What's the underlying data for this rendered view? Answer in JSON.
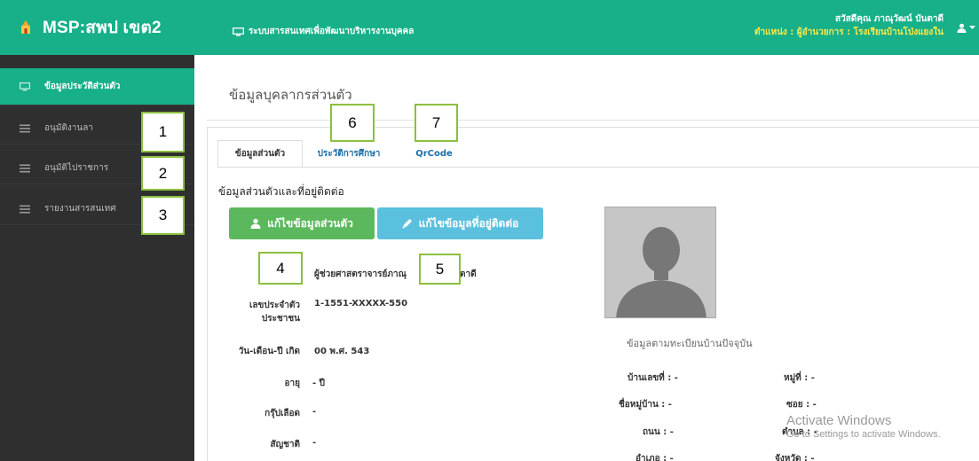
{
  "header": {
    "brand_title": "MSP:สพป เขต2",
    "system_title": "ระบบสารสนเทศเพื่อพัฒนาบริหารงานบุคคล",
    "user_greeting": "สวัสดีคุณ ภาณุวัฒน์ บันตาดี",
    "user_position": "ตำแหน่ง : ผู้อำนวยการ : โรงเรียนบ้านโป่งแยงใน",
    "brand_color": "#17b088"
  },
  "sidebar": {
    "items": [
      {
        "label": "ข้อมูลประวัติส่วนตัว",
        "icon": "monitor-icon"
      },
      {
        "label": "อนุมัติงานลา",
        "icon": "list-icon"
      },
      {
        "label": "อนุมัติไปราชการ",
        "icon": "list-icon"
      },
      {
        "label": "รายงานสารสนเทศ",
        "icon": "list-icon"
      }
    ]
  },
  "annotations": [
    "1",
    "2",
    "3",
    "4",
    "5",
    "6",
    "7"
  ],
  "main": {
    "page_title": "ข้อมูลบุคลากรส่วนตัว",
    "tabs": [
      "ข้อมูลส่วนตัว",
      "ประวัติการศึกษา",
      "QrCode"
    ],
    "section_title": "ข้อมูลส่วนตัวและที่อยู่ติดต่อ",
    "edit_personal_button": "แก้ไขข้อมูลส่วนตัว",
    "edit_address_button": "แก้ไขข้อมูลที่อยู่ติดต่อ",
    "name_left": "ผู้ช่วยศาสตราจารย์ภาณุ",
    "name_right": "ตาดี",
    "fields": [
      {
        "label": "เลขประจำตัว\nประชาชน",
        "value": "1-1551-XXXXX-550"
      },
      {
        "label": "วัน-เดือน-ปี เกิด",
        "value": "00 พ.ศ. 543"
      },
      {
        "label": "อายุ",
        "value": "- ปี"
      },
      {
        "label": "กรุ๊ปเลือด",
        "value": "-"
      },
      {
        "label": "สัญชาติ",
        "value": "-"
      }
    ],
    "address_title": "ข้อมูลตามทะเบียนบ้านปัจจุบัน",
    "address": [
      {
        "label": "บ้านเลขที่ : -"
      },
      {
        "label": "หมู่ที่ : -"
      },
      {
        "label": "ชื่อหมู่บ้าน : -"
      },
      {
        "label": "ซอย : -"
      },
      {
        "label": "ถนน : -"
      },
      {
        "label": "ตำบล : -"
      },
      {
        "label": "อำเภอ : -"
      },
      {
        "label": "จังหวัด : -"
      }
    ]
  },
  "watermark": {
    "title": "Activate Windows",
    "subtitle": "Go to Settings to activate Windows."
  }
}
